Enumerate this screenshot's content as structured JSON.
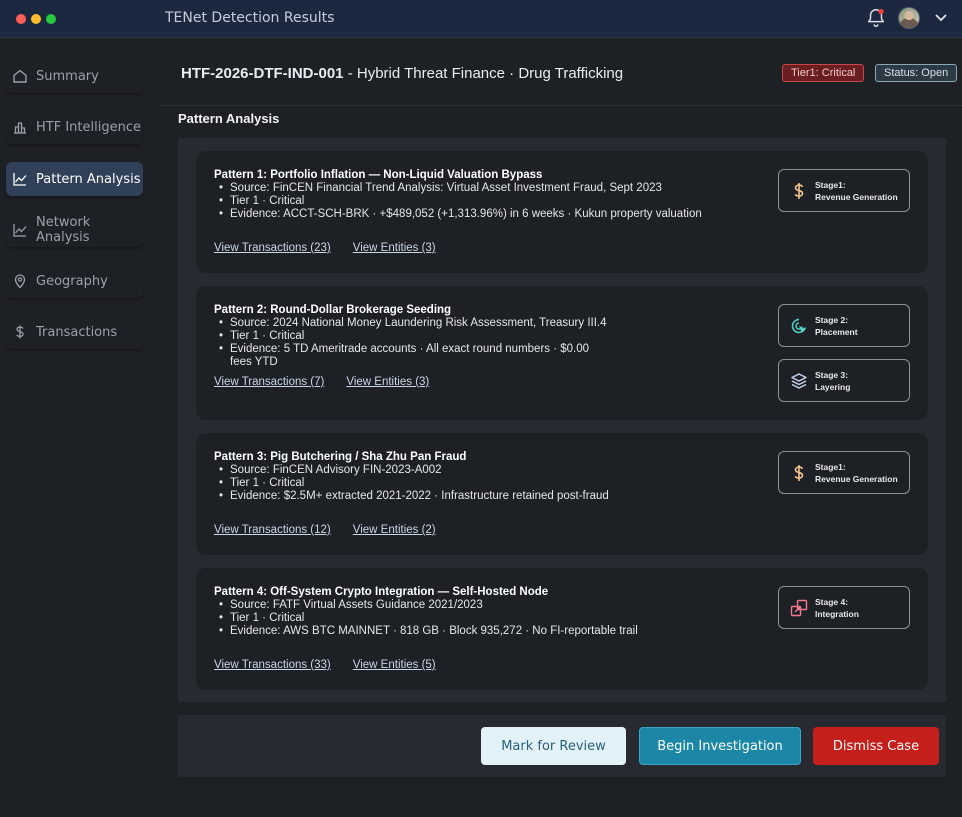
{
  "app": {
    "title": "TENet Detection Results"
  },
  "sidebar": {
    "items": [
      {
        "label": "Summary",
        "icon": "home-icon",
        "active": false
      },
      {
        "label": "HTF Intelligence",
        "icon": "bar-chart-icon",
        "active": false
      },
      {
        "label": "Pattern Analysis",
        "icon": "line-chart-icon",
        "active": true
      },
      {
        "label": "Network Analysis",
        "icon": "line-chart-icon",
        "active": false
      },
      {
        "label": "Geography",
        "icon": "map-pin-icon",
        "active": false
      },
      {
        "label": "Transactions",
        "icon": "dollar-icon",
        "active": false
      }
    ]
  },
  "header": {
    "case_id": "HTF-2026-DTF-IND-001",
    "case_desc": " - Hybrid Threat Finance · Drug Trafficking",
    "tier_badge": "Tier1: Critical",
    "status_badge": "Status: Open"
  },
  "section": {
    "title": "Pattern Analysis"
  },
  "patterns": [
    {
      "title": "Pattern 1: Portfolio Inflation — Non-Liquid Valuation Bypass",
      "bullets": [
        "Source: FinCEN Financial Trend Analysis: Virtual Asset Investment Fraud, Sept 2023",
        "Tier 1 · Critical",
        "Evidence: ACCT-SCH-BRK · +$489,052 (+1,313.96%) in 6 weeks · Kukun property valuation"
      ],
      "view_transactions": "View Transactions (23)",
      "view_entities": "View Entities (3)",
      "stages": [
        {
          "line1": "Stage1:",
          "line2": "Revenue Generation",
          "icon": "dollar-icon",
          "color": "#f5c58a"
        }
      ]
    },
    {
      "title": "Pattern 2: Round-Dollar Brokerage Seeding",
      "bullets": [
        "Source: 2024 National Money Laundering Risk Assessment, Treasury III.4",
        "Tier 1 · Critical",
        "Evidence: 5 TD Ameritrade accounts · All exact round numbers · $0.00 fees YTD"
      ],
      "view_transactions": "View Transactions (7)",
      "view_entities": "View Entities (3)",
      "stages": [
        {
          "line1": "Stage 2:",
          "line2": "Placement",
          "icon": "target-cursor-icon",
          "color": "#4fd1c5"
        },
        {
          "line1": "Stage 3:",
          "line2": "Layering",
          "icon": "layers-icon",
          "color": "#c8d4f0"
        }
      ]
    },
    {
      "title": "Pattern 3: Pig Butchering / Sha Zhu Pan Fraud",
      "bullets": [
        "Source: FinCEN Advisory FIN-2023-A002",
        "Tier 1 · Critical",
        "Evidence: $2.5M+ extracted 2021-2022 · Infrastructure retained post-fraud"
      ],
      "view_transactions": "View Transactions (12)",
      "view_entities": "View Entities (2)",
      "stages": [
        {
          "line1": "Stage1:",
          "line2": "Revenue Generation",
          "icon": "dollar-icon",
          "color": "#f5c58a"
        }
      ]
    },
    {
      "title": "Pattern 4: Off-System Crypto Integration — Self-Hosted Node",
      "bullets": [
        "Source: FATF Virtual Assets Guidance 2021/2023",
        "Tier 1 · Critical",
        "Evidence: AWS BTC MAINNET · 818 GB · Block 935,272 · No FI-reportable trail"
      ],
      "view_transactions": "View Transactions (33)",
      "view_entities": "View Entities (5)",
      "stages": [
        {
          "line1": "Stage 4:",
          "line2": "Integration",
          "icon": "integration-icon",
          "color": "#f07a8a"
        }
      ]
    }
  ],
  "actions": {
    "mark_review": "Mark for Review",
    "begin_investigation": "Begin Investigation",
    "dismiss_case": "Dismiss Case"
  }
}
